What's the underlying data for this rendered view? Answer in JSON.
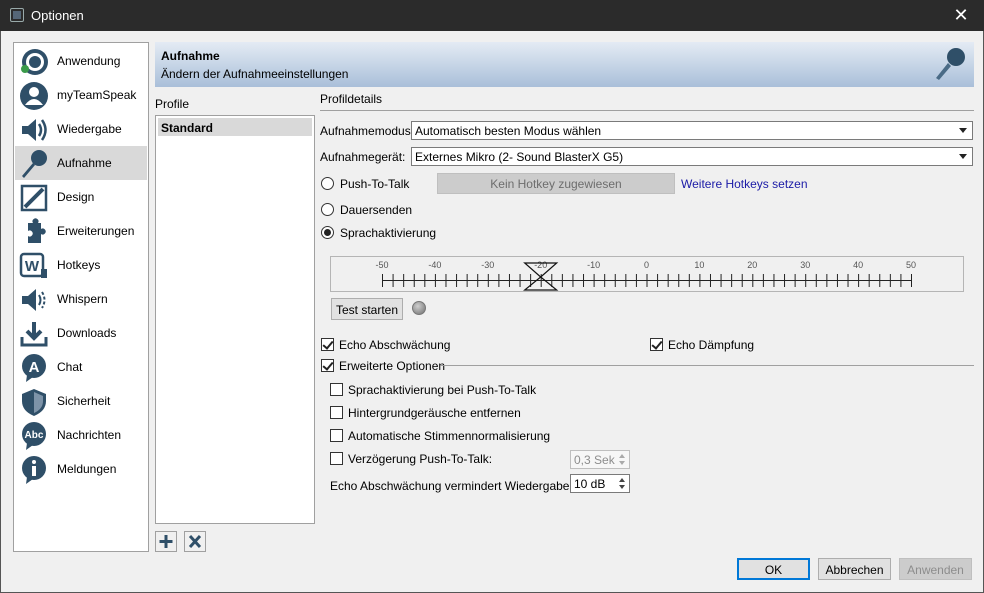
{
  "window": {
    "title": "Optionen",
    "close_glyph": "✕"
  },
  "sidebar": {
    "items": [
      {
        "label": "Anwendung",
        "icon": "teamspeak-logo-icon"
      },
      {
        "label": "myTeamSpeak",
        "icon": "user-profile-icon"
      },
      {
        "label": "Wiedergabe",
        "icon": "speaker-icon"
      },
      {
        "label": "Aufnahme",
        "icon": "microphone-icon",
        "active": true
      },
      {
        "label": "Design",
        "icon": "design-pencil-icon"
      },
      {
        "label": "Erweiterungen",
        "icon": "puzzle-icon"
      },
      {
        "label": "Hotkeys",
        "icon": "hotkey-w-icon"
      },
      {
        "label": "Whispern",
        "icon": "whisper-speaker-icon"
      },
      {
        "label": "Downloads",
        "icon": "download-icon"
      },
      {
        "label": "Chat",
        "icon": "chat-icon"
      },
      {
        "label": "Sicherheit",
        "icon": "shield-icon"
      },
      {
        "label": "Nachrichten",
        "icon": "abc-message-icon"
      },
      {
        "label": "Meldungen",
        "icon": "info-icon"
      }
    ]
  },
  "header": {
    "title": "Aufnahme",
    "subtitle": "Ändern der Aufnahmeeinstellungen",
    "icon": "microphone-icon"
  },
  "profiles": {
    "label": "Profile",
    "items": [
      "Standard"
    ],
    "add_icon": "plus-icon",
    "remove_icon": "x-icon"
  },
  "details": {
    "label": "Profildetails",
    "mode_label": "Aufnahmemodus:",
    "mode_value": "Automatisch besten Modus wählen",
    "device_label": "Aufnahmegerät:",
    "device_value": "Externes Mikro (2- Sound BlasterX G5)",
    "ptt_label": "Push-To-Talk",
    "hotkey_button": "Kein Hotkey zugewiesen",
    "hotkey_link": "Weitere Hotkeys setzen",
    "continuous_label": "Dauersenden",
    "voice_activation_label": "Sprachaktivierung",
    "selected_mode": "Sprachaktivierung",
    "meter": {
      "ticks": [
        "-50",
        "-40",
        "-30",
        "-20",
        "-10",
        "0",
        "10",
        "20",
        "30",
        "40",
        "50"
      ],
      "threshold": -20
    },
    "test_button": "Test starten",
    "echo_reduction_label": "Echo Abschwächung",
    "echo_reduction": true,
    "echo_cancel_label": "Echo Dämpfung",
    "echo_cancel": true,
    "advanced_label": "Erweiterte Optionen",
    "advanced": true,
    "va_during_ptt_label": "Sprachaktivierung bei Push-To-Talk",
    "remove_noise_label": "Hintergrundgeräusche entfernen",
    "auto_normalize_label": "Automatische Stimmennormalisierung",
    "ptt_delay_label": "Verzögerung Push-To-Talk:",
    "ptt_delay_value": "0,3 Sek",
    "echo_playback_label": "Echo Abschwächung vermindert Wiedergabe um:",
    "echo_playback_value": "10 dB"
  },
  "footer": {
    "ok": "OK",
    "cancel": "Abbrechen",
    "apply": "Anwenden"
  }
}
